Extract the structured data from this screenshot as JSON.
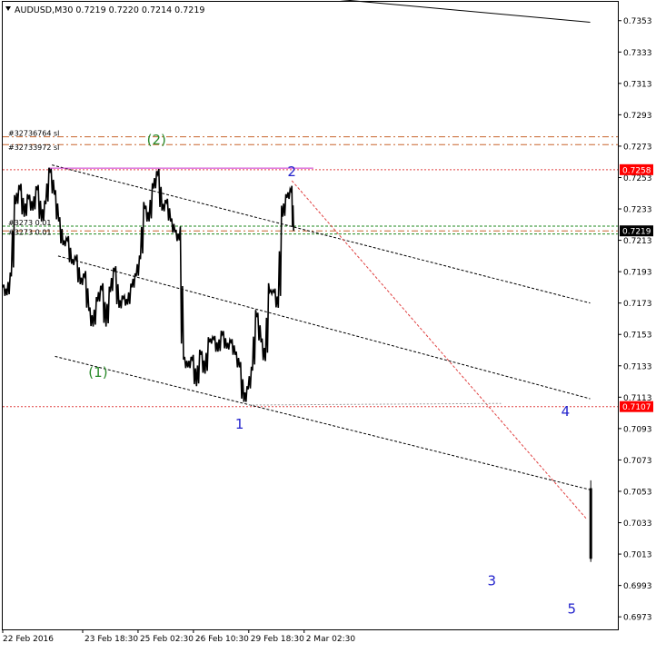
{
  "chart_data": {
    "type": "candlestick",
    "title": "AUDUSD,M30  0.7219 0.7220 0.7214 0.7219",
    "symbol": "AUDUSD",
    "timeframe": "M30",
    "ohlc": {
      "open": 0.7219,
      "high": 0.722,
      "low": 0.7214,
      "close": 0.7219
    },
    "ylim": [
      0.6965,
      0.7365
    ],
    "y_ticks": [
      "0.7353",
      "0.7333",
      "0.7313",
      "0.7293",
      "0.7273",
      "0.7253",
      "0.7233",
      "0.7213",
      "0.7193",
      "0.7173",
      "0.7153",
      "0.7133",
      "0.7113",
      "0.7093",
      "0.7073",
      "0.7053",
      "0.7033",
      "0.7013",
      "0.6993",
      "0.6973"
    ],
    "x_labels": [
      "22 Feb 2016",
      "23 Feb 18:30",
      "25 Feb 02:30",
      "26 Feb 10:30",
      "29 Feb 18:30",
      "2 Mar 02:30"
    ],
    "xlim": [
      0,
      100
    ],
    "x_label_pos": [
      0,
      13,
      22,
      31,
      40,
      49
    ],
    "price_labels": [
      {
        "text": "0.7258",
        "value": 0.7258,
        "color": "#ff0000"
      },
      {
        "text": "0.7219",
        "value": 0.7219,
        "color": "#000000"
      },
      {
        "text": "0.7107",
        "value": 0.7107,
        "color": "#ff0000"
      }
    ],
    "order_labels": [
      {
        "text": "#32736764 sl",
        "value": 0.7279
      },
      {
        "text": "#32733972 sl",
        "value": 0.7274
      },
      {
        "text": "#3273  0.01",
        "value": 0.7222
      },
      {
        "text": "#3273  0.01",
        "value": 0.722
      }
    ],
    "hlines": [
      {
        "value": 0.7279,
        "color": "#c8642d",
        "style": "dashdot"
      },
      {
        "value": 0.7274,
        "color": "#c8642d",
        "style": "dashdot"
      },
      {
        "value": 0.7258,
        "color": "#e04040",
        "style": "dotted"
      },
      {
        "value": 0.7222,
        "color": "#1f8a1f",
        "style": "dashed"
      },
      {
        "value": 0.7219,
        "color": "#c8642d",
        "style": "dashdot"
      },
      {
        "value": 0.7217,
        "color": "#1f8a1f",
        "style": "dashed"
      },
      {
        "value": 0.7107,
        "color": "#e04040",
        "style": "dotted"
      }
    ],
    "trendlines": [
      {
        "x1": 8,
        "y1": 0.7261,
        "x2": 95.5,
        "y2": 0.7173,
        "color": "#000000",
        "style": "dashed"
      },
      {
        "x1": 9,
        "y1": 0.7203,
        "x2": 95.5,
        "y2": 0.7112,
        "color": "#000000",
        "style": "dashed"
      },
      {
        "x1": 8.5,
        "y1": 0.7139,
        "x2": 95.5,
        "y2": 0.7054,
        "color": "#000000",
        "style": "dashed"
      },
      {
        "x1": 47,
        "y1": 0.7251,
        "x2": 95,
        "y2": 0.7035,
        "color": "#e04040",
        "style": "dashed"
      },
      {
        "x1": 7.5,
        "y1": 0.7259,
        "x2": 50.5,
        "y2": 0.7259,
        "color": "#cc33cc",
        "style": "solid"
      },
      {
        "x1": 40,
        "y1": 0.7108,
        "x2": 81,
        "y2": 0.7109,
        "color": "#999999",
        "style": "dotted"
      },
      {
        "x1": 42,
        "y1": 0.7371,
        "x2": 95.5,
        "y2": 0.7352,
        "color": "#000000",
        "style": "solid"
      }
    ],
    "wave_labels": [
      {
        "text": "(2)",
        "x": 25,
        "y": 0.7274,
        "color": "#2a8a2a"
      },
      {
        "text": "(1)",
        "x": 15.5,
        "y": 0.7126,
        "color": "#2a8a2a"
      },
      {
        "text": "2",
        "x": 47,
        "y": 0.7254,
        "color": "#2222cc"
      },
      {
        "text": "1",
        "x": 38.5,
        "y": 0.7093,
        "color": "#2222cc"
      },
      {
        "text": "4",
        "x": 91.5,
        "y": 0.7101,
        "color": "#2222cc"
      },
      {
        "text": "3",
        "x": 79.5,
        "y": 0.6993,
        "color": "#2222cc"
      },
      {
        "text": "5",
        "x": 92.5,
        "y": 0.6975,
        "color": "#2222cc"
      }
    ],
    "price_path": [
      [
        0,
        0.7183
      ],
      [
        0.7,
        0.7178
      ],
      [
        1.4,
        0.719
      ],
      [
        2.1,
        0.7236
      ],
      [
        2.8,
        0.7246
      ],
      [
        3.5,
        0.7228
      ],
      [
        4.2,
        0.724
      ],
      [
        4.9,
        0.7232
      ],
      [
        5.6,
        0.7245
      ],
      [
        6.3,
        0.7225
      ],
      [
        7.0,
        0.7236
      ],
      [
        7.7,
        0.7256
      ],
      [
        8.4,
        0.7242
      ],
      [
        9.1,
        0.7225
      ],
      [
        9.8,
        0.721
      ],
      [
        10.5,
        0.7213
      ],
      [
        11.2,
        0.7198
      ],
      [
        11.9,
        0.7201
      ],
      [
        12.6,
        0.7185
      ],
      [
        13.3,
        0.719
      ],
      [
        14.0,
        0.7168
      ],
      [
        14.7,
        0.7158
      ],
      [
        15.4,
        0.7174
      ],
      [
        16.1,
        0.7182
      ],
      [
        16.8,
        0.7158
      ],
      [
        17.5,
        0.718
      ],
      [
        18.2,
        0.7193
      ],
      [
        18.9,
        0.717
      ],
      [
        19.6,
        0.7176
      ],
      [
        20.3,
        0.7172
      ],
      [
        21.0,
        0.7183
      ],
      [
        21.7,
        0.719
      ],
      [
        22.4,
        0.7201
      ],
      [
        23.1,
        0.7233
      ],
      [
        23.8,
        0.7225
      ],
      [
        24.5,
        0.7246
      ],
      [
        25.2,
        0.7255
      ],
      [
        25.9,
        0.7232
      ],
      [
        26.6,
        0.7237
      ],
      [
        27.3,
        0.7225
      ],
      [
        28.0,
        0.7218
      ],
      [
        28.7,
        0.7213
      ],
      [
        29.4,
        0.7137
      ],
      [
        30.1,
        0.7132
      ],
      [
        30.8,
        0.7137
      ],
      [
        31.5,
        0.712
      ],
      [
        32.2,
        0.714
      ],
      [
        32.9,
        0.7128
      ],
      [
        33.6,
        0.7148
      ],
      [
        34.3,
        0.715
      ],
      [
        35.0,
        0.7142
      ],
      [
        35.7,
        0.7153
      ],
      [
        36.4,
        0.7144
      ],
      [
        37.1,
        0.7148
      ],
      [
        37.8,
        0.714
      ],
      [
        38.5,
        0.7132
      ],
      [
        39.2,
        0.711
      ],
      [
        39.9,
        0.7118
      ],
      [
        40.6,
        0.713
      ],
      [
        41.3,
        0.7164
      ],
      [
        42.0,
        0.7148
      ],
      [
        42.7,
        0.7136
      ],
      [
        43.4,
        0.718
      ],
      [
        44.1,
        0.718
      ],
      [
        44.8,
        0.717
      ],
      [
        45.5,
        0.7228
      ],
      [
        46.2,
        0.724
      ],
      [
        46.9,
        0.7244
      ],
      [
        47.3,
        0.7219
      ]
    ],
    "last_candle": {
      "x": 95.6,
      "open": 0.7055,
      "high": 0.706,
      "low": 0.7008,
      "close": 0.701
    }
  }
}
